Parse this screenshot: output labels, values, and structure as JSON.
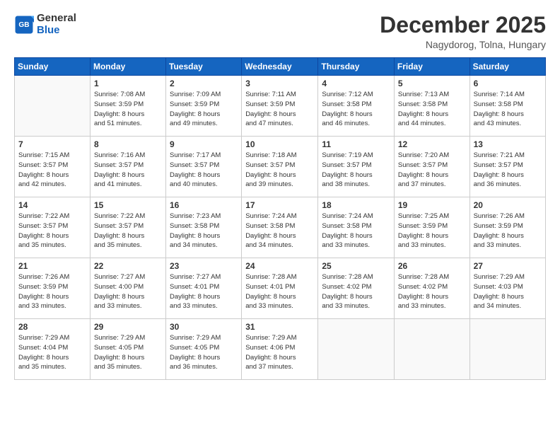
{
  "header": {
    "logo_line1": "General",
    "logo_line2": "Blue",
    "month": "December 2025",
    "location": "Nagydorog, Tolna, Hungary"
  },
  "weekdays": [
    "Sunday",
    "Monday",
    "Tuesday",
    "Wednesday",
    "Thursday",
    "Friday",
    "Saturday"
  ],
  "weeks": [
    [
      {
        "day": "",
        "info": ""
      },
      {
        "day": "1",
        "info": "Sunrise: 7:08 AM\nSunset: 3:59 PM\nDaylight: 8 hours\nand 51 minutes."
      },
      {
        "day": "2",
        "info": "Sunrise: 7:09 AM\nSunset: 3:59 PM\nDaylight: 8 hours\nand 49 minutes."
      },
      {
        "day": "3",
        "info": "Sunrise: 7:11 AM\nSunset: 3:59 PM\nDaylight: 8 hours\nand 47 minutes."
      },
      {
        "day": "4",
        "info": "Sunrise: 7:12 AM\nSunset: 3:58 PM\nDaylight: 8 hours\nand 46 minutes."
      },
      {
        "day": "5",
        "info": "Sunrise: 7:13 AM\nSunset: 3:58 PM\nDaylight: 8 hours\nand 44 minutes."
      },
      {
        "day": "6",
        "info": "Sunrise: 7:14 AM\nSunset: 3:58 PM\nDaylight: 8 hours\nand 43 minutes."
      }
    ],
    [
      {
        "day": "7",
        "info": "Sunrise: 7:15 AM\nSunset: 3:57 PM\nDaylight: 8 hours\nand 42 minutes."
      },
      {
        "day": "8",
        "info": "Sunrise: 7:16 AM\nSunset: 3:57 PM\nDaylight: 8 hours\nand 41 minutes."
      },
      {
        "day": "9",
        "info": "Sunrise: 7:17 AM\nSunset: 3:57 PM\nDaylight: 8 hours\nand 40 minutes."
      },
      {
        "day": "10",
        "info": "Sunrise: 7:18 AM\nSunset: 3:57 PM\nDaylight: 8 hours\nand 39 minutes."
      },
      {
        "day": "11",
        "info": "Sunrise: 7:19 AM\nSunset: 3:57 PM\nDaylight: 8 hours\nand 38 minutes."
      },
      {
        "day": "12",
        "info": "Sunrise: 7:20 AM\nSunset: 3:57 PM\nDaylight: 8 hours\nand 37 minutes."
      },
      {
        "day": "13",
        "info": "Sunrise: 7:21 AM\nSunset: 3:57 PM\nDaylight: 8 hours\nand 36 minutes."
      }
    ],
    [
      {
        "day": "14",
        "info": "Sunrise: 7:22 AM\nSunset: 3:57 PM\nDaylight: 8 hours\nand 35 minutes."
      },
      {
        "day": "15",
        "info": "Sunrise: 7:22 AM\nSunset: 3:57 PM\nDaylight: 8 hours\nand 35 minutes."
      },
      {
        "day": "16",
        "info": "Sunrise: 7:23 AM\nSunset: 3:58 PM\nDaylight: 8 hours\nand 34 minutes."
      },
      {
        "day": "17",
        "info": "Sunrise: 7:24 AM\nSunset: 3:58 PM\nDaylight: 8 hours\nand 34 minutes."
      },
      {
        "day": "18",
        "info": "Sunrise: 7:24 AM\nSunset: 3:58 PM\nDaylight: 8 hours\nand 33 minutes."
      },
      {
        "day": "19",
        "info": "Sunrise: 7:25 AM\nSunset: 3:59 PM\nDaylight: 8 hours\nand 33 minutes."
      },
      {
        "day": "20",
        "info": "Sunrise: 7:26 AM\nSunset: 3:59 PM\nDaylight: 8 hours\nand 33 minutes."
      }
    ],
    [
      {
        "day": "21",
        "info": "Sunrise: 7:26 AM\nSunset: 3:59 PM\nDaylight: 8 hours\nand 33 minutes."
      },
      {
        "day": "22",
        "info": "Sunrise: 7:27 AM\nSunset: 4:00 PM\nDaylight: 8 hours\nand 33 minutes."
      },
      {
        "day": "23",
        "info": "Sunrise: 7:27 AM\nSunset: 4:01 PM\nDaylight: 8 hours\nand 33 minutes."
      },
      {
        "day": "24",
        "info": "Sunrise: 7:28 AM\nSunset: 4:01 PM\nDaylight: 8 hours\nand 33 minutes."
      },
      {
        "day": "25",
        "info": "Sunrise: 7:28 AM\nSunset: 4:02 PM\nDaylight: 8 hours\nand 33 minutes."
      },
      {
        "day": "26",
        "info": "Sunrise: 7:28 AM\nSunset: 4:02 PM\nDaylight: 8 hours\nand 33 minutes."
      },
      {
        "day": "27",
        "info": "Sunrise: 7:29 AM\nSunset: 4:03 PM\nDaylight: 8 hours\nand 34 minutes."
      }
    ],
    [
      {
        "day": "28",
        "info": "Sunrise: 7:29 AM\nSunset: 4:04 PM\nDaylight: 8 hours\nand 35 minutes."
      },
      {
        "day": "29",
        "info": "Sunrise: 7:29 AM\nSunset: 4:05 PM\nDaylight: 8 hours\nand 35 minutes."
      },
      {
        "day": "30",
        "info": "Sunrise: 7:29 AM\nSunset: 4:05 PM\nDaylight: 8 hours\nand 36 minutes."
      },
      {
        "day": "31",
        "info": "Sunrise: 7:29 AM\nSunset: 4:06 PM\nDaylight: 8 hours\nand 37 minutes."
      },
      {
        "day": "",
        "info": ""
      },
      {
        "day": "",
        "info": ""
      },
      {
        "day": "",
        "info": ""
      }
    ]
  ]
}
